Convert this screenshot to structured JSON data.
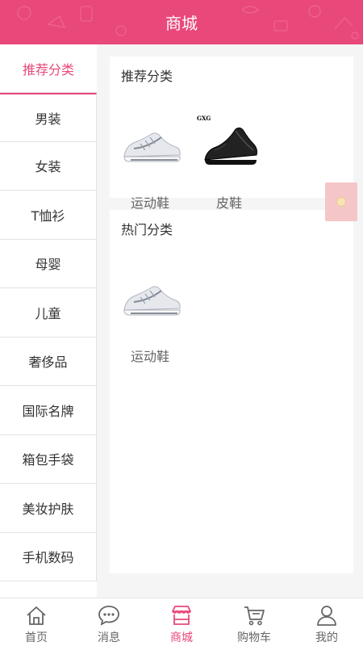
{
  "header": {
    "title": "商城"
  },
  "sidebar": {
    "items": [
      {
        "label": "推荐分类",
        "active": true
      },
      {
        "label": "男装"
      },
      {
        "label": "女装"
      },
      {
        "label": "T恤衫"
      },
      {
        "label": "母婴"
      },
      {
        "label": "儿童"
      },
      {
        "label": "奢侈品"
      },
      {
        "label": "国际名牌"
      },
      {
        "label": "箱包手袋"
      },
      {
        "label": "美妆护肤"
      },
      {
        "label": "手机数码"
      }
    ]
  },
  "recommended": {
    "title": "推荐分类",
    "items": [
      {
        "label": "运动鞋",
        "icon": "sneaker-image"
      },
      {
        "label": "皮鞋",
        "icon": "leather-shoe-image",
        "brand": "GXG"
      }
    ]
  },
  "hot": {
    "title": "热门分类",
    "items": [
      {
        "label": "运动鞋",
        "icon": "sneaker-image"
      }
    ]
  },
  "tabbar": {
    "items": [
      {
        "label": "首页",
        "icon": "home-icon"
      },
      {
        "label": "消息",
        "icon": "message-icon"
      },
      {
        "label": "商城",
        "icon": "shop-icon",
        "active": true
      },
      {
        "label": "购物车",
        "icon": "cart-icon"
      },
      {
        "label": "我的",
        "icon": "user-icon"
      }
    ]
  },
  "colors": {
    "accent": "#e9487a",
    "background": "#f5f5f5"
  }
}
